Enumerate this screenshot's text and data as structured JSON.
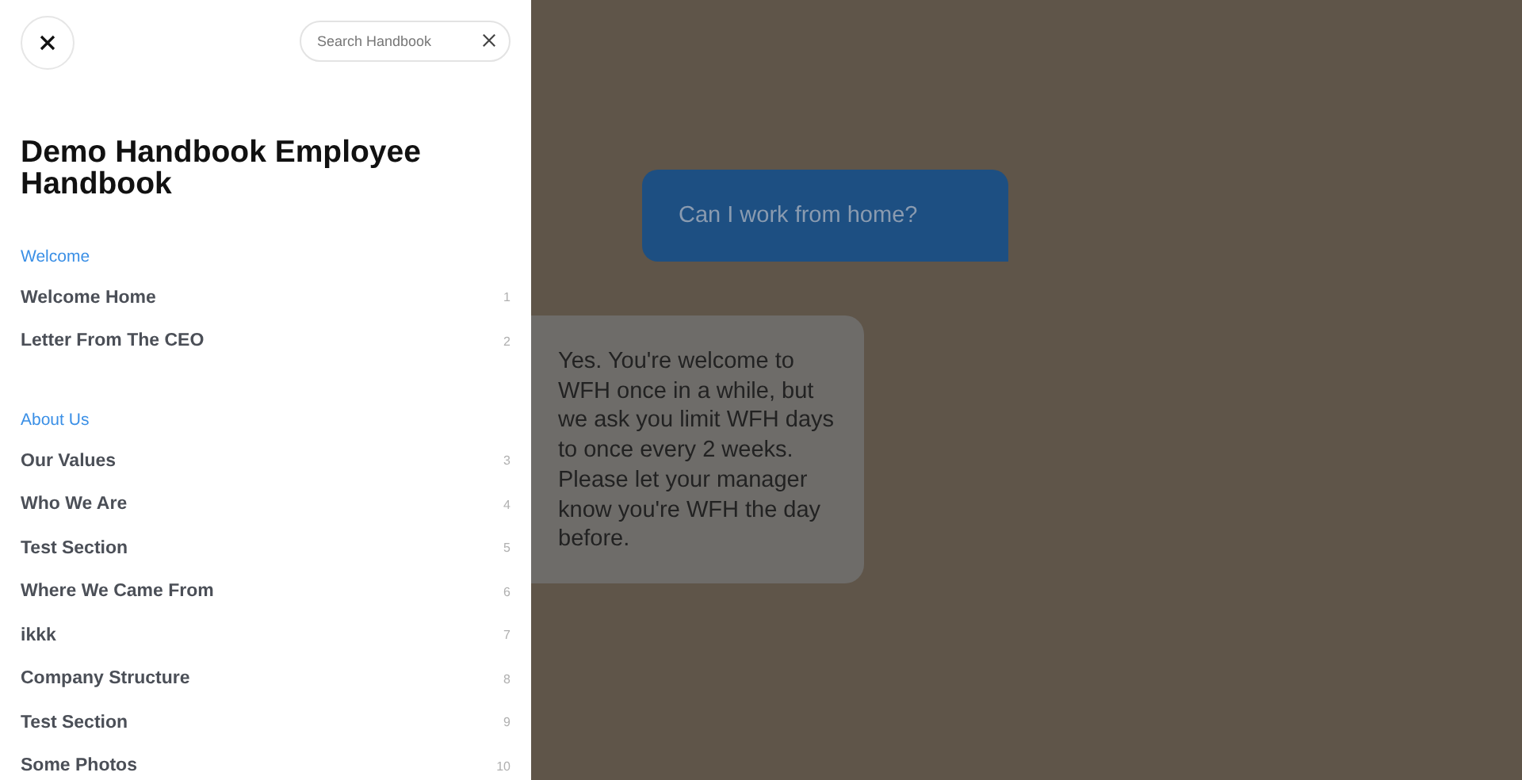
{
  "search": {
    "placeholder": "Search Handbook"
  },
  "title": "Demo Handbook Employee Handbook",
  "sections": [
    {
      "heading": "Welcome",
      "items": [
        {
          "label": "Welcome Home",
          "page": "1"
        },
        {
          "label": "Letter From The CEO",
          "page": "2"
        }
      ]
    },
    {
      "heading": "About Us",
      "items": [
        {
          "label": "Our Values",
          "page": "3"
        },
        {
          "label": "Who We Are",
          "page": "4"
        },
        {
          "label": "Test Section",
          "page": "5"
        },
        {
          "label": "Where We Came From",
          "page": "6"
        },
        {
          "label": "ikkk",
          "page": "7"
        },
        {
          "label": "Company Structure",
          "page": "8"
        },
        {
          "label": "Test Section",
          "page": "9"
        },
        {
          "label": "Some Photos",
          "page": "10"
        }
      ]
    }
  ],
  "messages": [
    {
      "kind": "question",
      "text": "Can I work from home?"
    },
    {
      "kind": "answer",
      "text": "Yes. You're welcome to WFH once in a while, but we ask you limit WFH days to once every 2 weeks. Please let your manager know you're WFH the day before."
    }
  ]
}
